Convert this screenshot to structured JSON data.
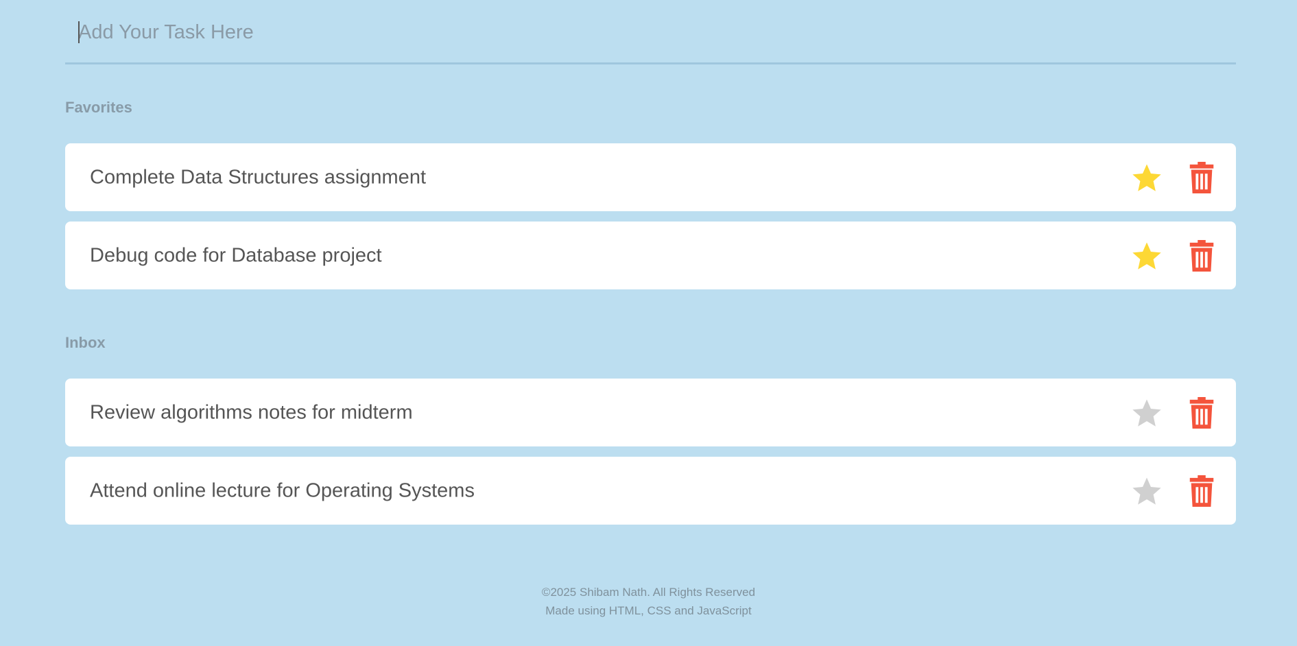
{
  "input": {
    "placeholder": "Add Your Task Here",
    "value": ""
  },
  "sections": {
    "favorites": {
      "title": "Favorites",
      "tasks": [
        {
          "text": "Complete Data Structures assignment",
          "favorite": true
        },
        {
          "text": "Debug code for Database project",
          "favorite": true
        }
      ]
    },
    "inbox": {
      "title": "Inbox",
      "tasks": [
        {
          "text": "Review algorithms notes for midterm",
          "favorite": false
        },
        {
          "text": "Attend online lecture for Operating Systems",
          "favorite": false
        }
      ]
    }
  },
  "icons": {
    "star": "star-icon",
    "trash": "trash-icon"
  },
  "colors": {
    "background": "#bcdef0",
    "star_active": "#fdd835",
    "star_inactive": "#d0d0d0",
    "trash": "#f4543c"
  },
  "footer": {
    "line1": "©2025 Shibam Nath. All Rights Reserved",
    "line2": "Made using HTML, CSS and JavaScript"
  }
}
